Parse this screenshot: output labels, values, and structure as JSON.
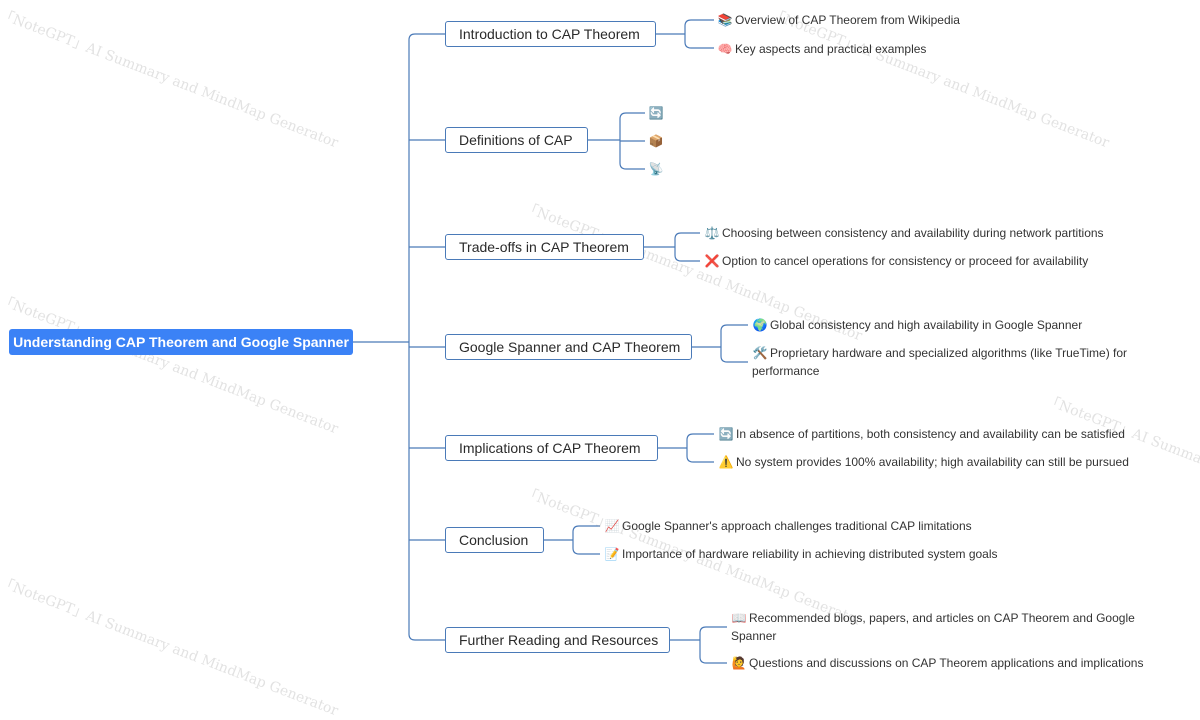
{
  "root": {
    "label": "Understanding CAP Theorem and Google Spanner"
  },
  "branches": [
    {
      "label": "Introduction to CAP Theorem",
      "leaves": [
        {
          "icon": "📚",
          "icon_name": "books-icon",
          "text": "Overview of CAP Theorem from Wikipedia"
        },
        {
          "icon": "🧠",
          "icon_name": "brain-icon",
          "text": "Key aspects and practical examples"
        }
      ]
    },
    {
      "label": "Definitions of CAP",
      "leaves": [
        {
          "icon": "🔄",
          "icon_name": "refresh-icon",
          "text": ""
        },
        {
          "icon": "📦",
          "icon_name": "package-icon",
          "text": ""
        },
        {
          "icon": "📡",
          "icon_name": "satellite-dish-icon",
          "text": ""
        }
      ]
    },
    {
      "label": "Trade-offs in CAP Theorem",
      "leaves": [
        {
          "icon": "⚖️",
          "icon_name": "balance-scale-icon",
          "text": "Choosing between consistency and availability during network partitions"
        },
        {
          "icon": "❌",
          "icon_name": "cross-mark-icon",
          "text": "Option to cancel operations for consistency or proceed for availability"
        }
      ]
    },
    {
      "label": "Google Spanner and CAP Theorem",
      "leaves": [
        {
          "icon": "🌍",
          "icon_name": "globe-icon",
          "text": "Global consistency and high availability in Google Spanner"
        },
        {
          "icon": "🛠️",
          "icon_name": "tools-icon",
          "text": "Proprietary hardware and specialized algorithms (like TrueTime) for performance"
        }
      ]
    },
    {
      "label": "Implications of CAP Theorem",
      "leaves": [
        {
          "icon": "🔄",
          "icon_name": "refresh-icon",
          "text": "In absence of partitions, both consistency and availability can be satisfied"
        },
        {
          "icon": "⚠️",
          "icon_name": "warning-icon",
          "text": "No system provides 100% availability; high availability can still be pursued"
        }
      ]
    },
    {
      "label": "Conclusion",
      "leaves": [
        {
          "icon": "📈",
          "icon_name": "chart-up-icon",
          "text": "Google Spanner's approach challenges traditional CAP limitations"
        },
        {
          "icon": "📝",
          "icon_name": "memo-icon",
          "text": "Importance of hardware reliability in achieving distributed system goals"
        }
      ]
    },
    {
      "label": "Further Reading and Resources",
      "leaves": [
        {
          "icon": "📖",
          "icon_name": "open-book-icon",
          "text": "Recommended blogs, papers, and articles on CAP Theorem and Google Spanner"
        },
        {
          "icon": "🙋",
          "icon_name": "person-raising-hand-icon",
          "text": "Questions and discussions on CAP Theorem applications and implications"
        }
      ]
    }
  ],
  "watermark": "「NoteGPT」AI Summary and MindMap Generator",
  "colors": {
    "root_bg": "#3b82f6",
    "root_text": "#ffffff",
    "branch_border": "#4a7ab8",
    "connector": "#4a7ab8"
  }
}
